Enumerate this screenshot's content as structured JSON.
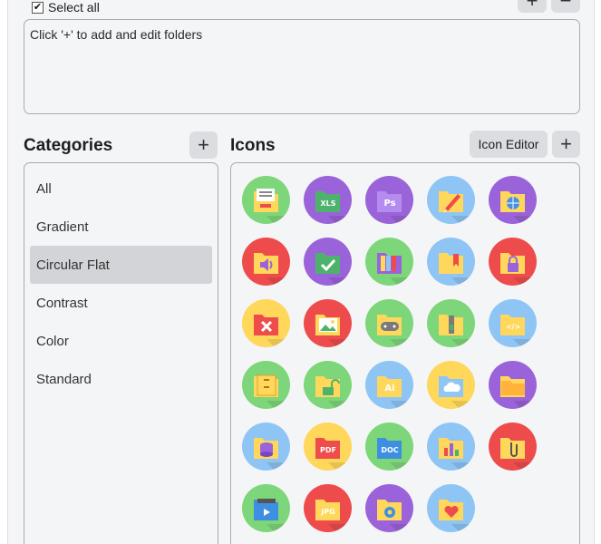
{
  "select_all": {
    "label": "Select all",
    "checked": true
  },
  "top_buttons": {
    "add": "+",
    "remove": "−"
  },
  "folders": {
    "hint": "Click '+' to add and edit folders"
  },
  "categories": {
    "title": "Categories",
    "add": "+",
    "items": [
      {
        "label": "All"
      },
      {
        "label": "Gradient"
      },
      {
        "label": "Circular Flat",
        "selected": true
      },
      {
        "label": "Contrast"
      },
      {
        "label": "Color"
      },
      {
        "label": "Standard"
      }
    ]
  },
  "icons": {
    "title": "Icons",
    "editor_label": "Icon Editor",
    "add": "+",
    "items": [
      {
        "name": "document-folder-icon",
        "bg": "#7dd67a",
        "folder": "#ffd75a",
        "label": "",
        "glyph": "doc"
      },
      {
        "name": "xls-folder-icon",
        "bg": "#9b63d9",
        "folder": "#4cb26c",
        "label": "XLS",
        "glyph": ""
      },
      {
        "name": "photoshop-folder-icon",
        "bg": "#9b63d9",
        "folder": "#b48cf0",
        "label": "Ps",
        "glyph": ""
      },
      {
        "name": "edit-folder-icon",
        "bg": "#8ec5f5",
        "folder": "#ffd75a",
        "label": "",
        "glyph": "pencil"
      },
      {
        "name": "web-folder-icon",
        "bg": "#9b63d9",
        "folder": "#ffd75a",
        "label": "",
        "glyph": "globe"
      },
      {
        "name": "audio-folder-icon",
        "bg": "#ee4c4c",
        "folder": "#ffd75a",
        "label": "",
        "glyph": "speaker"
      },
      {
        "name": "checked-folder-icon",
        "bg": "#9b63d9",
        "folder": "#4cb26c",
        "label": "",
        "glyph": "check"
      },
      {
        "name": "library-folder-icon",
        "bg": "#7dd67a",
        "folder": "#9b63d9",
        "label": "",
        "glyph": "books"
      },
      {
        "name": "bookmark-folder-icon",
        "bg": "#8ec5f5",
        "folder": "#ffd75a",
        "label": "",
        "glyph": "bookmark"
      },
      {
        "name": "locked-folder-icon",
        "bg": "#ee4c4c",
        "folder": "#ffd75a",
        "label": "",
        "glyph": "lock"
      },
      {
        "name": "delete-folder-icon",
        "bg": "#ffd75a",
        "folder": "#ee4c4c",
        "label": "",
        "glyph": "x"
      },
      {
        "name": "pictures-folder-icon",
        "bg": "#ee4c4c",
        "folder": "#ffd75a",
        "label": "",
        "glyph": "picture"
      },
      {
        "name": "games-folder-icon",
        "bg": "#7dd67a",
        "folder": "#ffd75a",
        "label": "",
        "glyph": "gamepad"
      },
      {
        "name": "archive-folder-icon",
        "bg": "#7dd67a",
        "folder": "#ffd75a",
        "label": "",
        "glyph": "zip"
      },
      {
        "name": "code-folder-icon",
        "bg": "#8ec5f5",
        "folder": "#ffd75a",
        "label": "</>",
        "glyph": ""
      },
      {
        "name": "cabinet-folder-icon",
        "bg": "#7dd67a",
        "folder": "#ffd75a",
        "label": "",
        "glyph": "cabinet"
      },
      {
        "name": "unlocked-folder-icon",
        "bg": "#7dd67a",
        "folder": "#ffd75a",
        "label": "",
        "glyph": "unlock"
      },
      {
        "name": "illustrator-folder-icon",
        "bg": "#8ec5f5",
        "folder": "#ffd75a",
        "label": "Ai",
        "glyph": ""
      },
      {
        "name": "cloud-folder-icon",
        "bg": "#ffd75a",
        "folder": "#8ec5f5",
        "label": "",
        "glyph": "cloud"
      },
      {
        "name": "open-folder-icon",
        "bg": "#9b63d9",
        "folder": "#ffd75a",
        "label": "",
        "glyph": "open"
      },
      {
        "name": "database-folder-icon",
        "bg": "#8ec5f5",
        "folder": "#ffd75a",
        "label": "",
        "glyph": "database"
      },
      {
        "name": "pdf-folder-icon",
        "bg": "#ffd75a",
        "folder": "#ee4c4c",
        "label": "PDF",
        "glyph": ""
      },
      {
        "name": "doc-folder-icon",
        "bg": "#7dd67a",
        "folder": "#3e8fe0",
        "label": "DOC",
        "glyph": ""
      },
      {
        "name": "chart-folder-icon",
        "bg": "#8ec5f5",
        "folder": "#ffd75a",
        "label": "",
        "glyph": "chart"
      },
      {
        "name": "attachment-folder-icon",
        "bg": "#ee4c4c",
        "folder": "#ffd75a",
        "label": "",
        "glyph": "clip"
      },
      {
        "name": "video-folder-icon",
        "bg": "#7dd67a",
        "folder": "#3e8fe0",
        "label": "",
        "glyph": "play"
      },
      {
        "name": "jpg-folder-icon",
        "bg": "#ee4c4c",
        "folder": "#ffd75a",
        "label": "JPG",
        "glyph": ""
      },
      {
        "name": "settings-folder-icon",
        "bg": "#9b63d9",
        "folder": "#ffd75a",
        "label": "",
        "glyph": "gear"
      },
      {
        "name": "favorites-folder-icon",
        "bg": "#8ec5f5",
        "folder": "#ffd75a",
        "label": "",
        "glyph": "heart"
      }
    ]
  }
}
